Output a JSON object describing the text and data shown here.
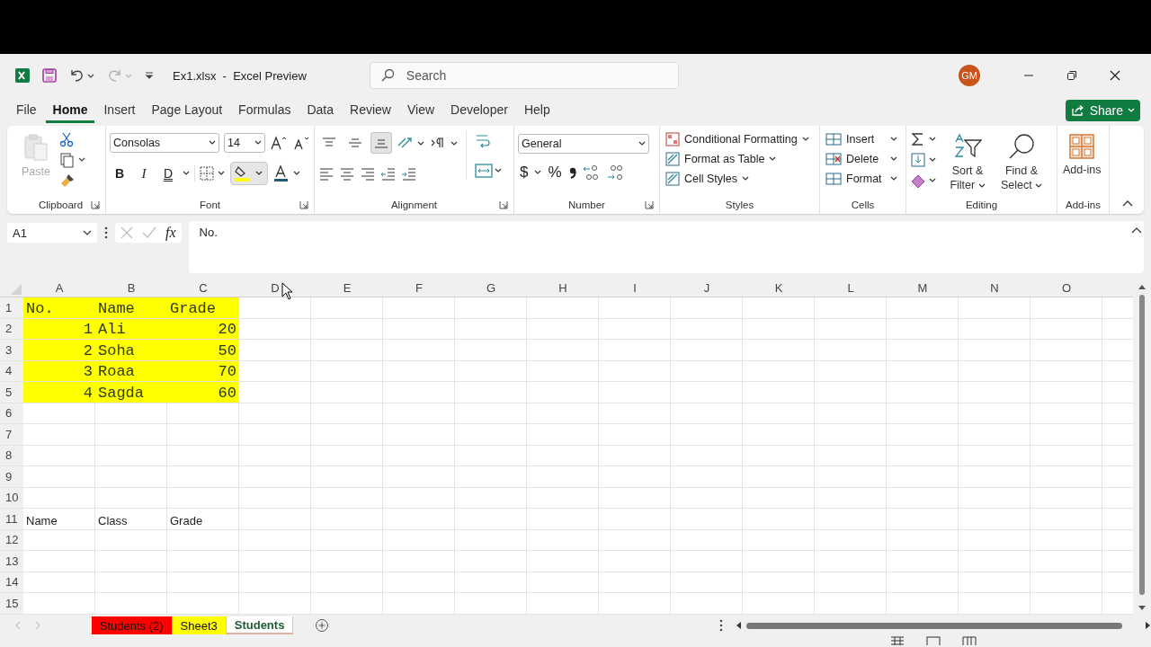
{
  "title_bar": {
    "file_name": "Ex1.xlsx  -  Excel Preview",
    "search_placeholder": "Search",
    "avatar": "GM",
    "redo_disabled": true
  },
  "tabs": [
    {
      "label": "File",
      "selected": false
    },
    {
      "label": "Home",
      "selected": true
    },
    {
      "label": "Insert",
      "selected": false
    },
    {
      "label": "Page Layout",
      "selected": false
    },
    {
      "label": "Formulas",
      "selected": false
    },
    {
      "label": "Data",
      "selected": false
    },
    {
      "label": "Review",
      "selected": false
    },
    {
      "label": "View",
      "selected": false
    },
    {
      "label": "Developer",
      "selected": false
    },
    {
      "label": "Help",
      "selected": false
    }
  ],
  "share_button": "Share",
  "ribbon": {
    "groups": [
      {
        "kind": "clipboard",
        "label": "Clipboard",
        "paste": "Paste",
        "paste_disabled": true
      },
      {
        "kind": "font",
        "label": "Font",
        "font_name": "Consolas",
        "font_size": "14",
        "bold": "B",
        "italic": "I",
        "underline": "D",
        "fill_hovered": true
      },
      {
        "kind": "alignment",
        "label": "Alignment",
        "vertical": [
          {
            "selected": false
          },
          {
            "selected": false
          },
          {
            "selected": true
          }
        ]
      },
      {
        "kind": "number",
        "label": "Number",
        "format": "General",
        "currency": "$",
        "percent": "%"
      },
      {
        "kind": "styles",
        "label": "Styles",
        "items": [
          "Conditional Formatting",
          "Format as Table",
          "Cell Styles"
        ]
      },
      {
        "kind": "cells",
        "label": "Cells",
        "items": [
          "Insert",
          "Delete",
          "Format"
        ]
      },
      {
        "kind": "editing",
        "label": "Editing",
        "sort": "Sort & Filter",
        "find": "Find & Select"
      },
      {
        "kind": "addins",
        "label": "Add-ins",
        "button": "Add-ins"
      }
    ]
  },
  "formula_bar": {
    "name_box": "A1",
    "fx": "fx",
    "content": "No."
  },
  "sheet": {
    "columns": [
      "A",
      "B",
      "C",
      "D",
      "E",
      "F",
      "G",
      "H",
      "I",
      "J",
      "K",
      "L",
      "M",
      "N",
      "O"
    ],
    "rows": [
      {
        "number": "1",
        "cells": [
          {
            "text": "No.",
            "kind": "text",
            "monospace": true,
            "highlighted": true
          },
          {
            "text": "Name",
            "kind": "text",
            "monospace": true,
            "highlighted": true
          },
          {
            "text": "Grade",
            "kind": "text",
            "monospace": true,
            "highlighted": true
          }
        ]
      },
      {
        "number": "2",
        "cells": [
          {
            "text": "1",
            "kind": "number",
            "monospace": true,
            "highlighted": true
          },
          {
            "text": "Ali",
            "kind": "text",
            "monospace": true,
            "highlighted": true
          },
          {
            "text": "20",
            "kind": "number",
            "monospace": true,
            "highlighted": true
          }
        ]
      },
      {
        "number": "3",
        "cells": [
          {
            "text": "2",
            "kind": "number",
            "monospace": true,
            "highlighted": true
          },
          {
            "text": "Soha",
            "kind": "text",
            "monospace": true,
            "highlighted": true
          },
          {
            "text": "50",
            "kind": "number",
            "monospace": true,
            "highlighted": true
          }
        ]
      },
      {
        "number": "4",
        "cells": [
          {
            "text": "3",
            "kind": "number",
            "monospace": true,
            "highlighted": true
          },
          {
            "text": "Roaa",
            "kind": "text",
            "monospace": true,
            "highlighted": true
          },
          {
            "text": "70",
            "kind": "number",
            "monospace": true,
            "highlighted": true
          }
        ]
      },
      {
        "number": "5",
        "cells": [
          {
            "text": "4",
            "kind": "number",
            "monospace": true,
            "highlighted": true
          },
          {
            "text": "Sagda",
            "kind": "text",
            "monospace": true,
            "highlighted": true
          },
          {
            "text": "60",
            "kind": "number",
            "monospace": true,
            "highlighted": true
          }
        ]
      },
      {
        "number": "6"
      },
      {
        "number": "7"
      },
      {
        "number": "8"
      },
      {
        "number": "9"
      },
      {
        "number": "10"
      },
      {
        "number": "11",
        "cells": [
          {
            "text": "Name",
            "kind": "text",
            "monospace": false,
            "highlighted": false
          },
          {
            "text": "Class",
            "kind": "text",
            "monospace": false,
            "highlighted": false
          },
          {
            "text": "Grade",
            "kind": "text",
            "monospace": false,
            "highlighted": false
          }
        ]
      },
      {
        "number": "12"
      },
      {
        "number": "13"
      },
      {
        "number": "14"
      },
      {
        "number": "15"
      }
    ]
  },
  "sheet_tabs": [
    {
      "label": "Students (2)",
      "color": "#ff0000",
      "selected": false
    },
    {
      "label": "Sheet3",
      "color": "#ffff00",
      "selected": false
    },
    {
      "label": "Students",
      "selected": true
    }
  ]
}
